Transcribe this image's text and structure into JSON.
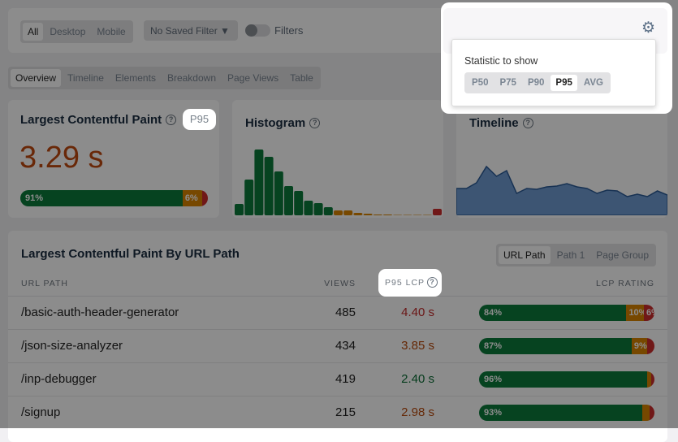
{
  "filters": {
    "device_options": [
      "All",
      "Desktop",
      "Mobile"
    ],
    "device_selected": "All",
    "saved_filter": "No Saved Filter",
    "toggle_label": "Filters"
  },
  "tabs": [
    "Overview",
    "Timeline",
    "Elements",
    "Breakdown",
    "Page Views",
    "Table"
  ],
  "active_tab": "Overview",
  "lcp_card": {
    "title": "Largest Contentful Paint",
    "badge": "P95",
    "value": "3.29 s",
    "rating": {
      "good": 91,
      "needs_improvement": 6,
      "poor": 3
    },
    "good_label": "91%",
    "ni_label": "6%"
  },
  "histogram": {
    "title": "Histogram",
    "bars": [
      14,
      44,
      81,
      72,
      54,
      36,
      30,
      18,
      15,
      10,
      6,
      6,
      3,
      2,
      1,
      1,
      0,
      0,
      0,
      0,
      8
    ],
    "colors": {
      "good": "#0b7a3b",
      "ni": "#d98400",
      "poor": "#cc2d2d"
    }
  },
  "timeline": {
    "title": "Timeline",
    "values": [
      33,
      33,
      40,
      60,
      48,
      55,
      27,
      33,
      32,
      35,
      36,
      39,
      35,
      33,
      27,
      31,
      30,
      23,
      26,
      23,
      30,
      25
    ],
    "color": "#2a5a96"
  },
  "popover": {
    "title": "Statistic to show",
    "options": [
      "P50",
      "P75",
      "P90",
      "P95",
      "AVG"
    ],
    "selected": "P95"
  },
  "table": {
    "title": "Largest Contentful Paint By URL Path",
    "group_options": [
      "URL Path",
      "Path 1",
      "Page Group"
    ],
    "group_selected": "URL Path",
    "headers": {
      "path": "URL PATH",
      "views": "VIEWS",
      "lcp": "P95 LCP",
      "rating": "LCP RATING"
    },
    "rows": [
      {
        "path": "/basic-auth-header-generator",
        "views": "485",
        "lcp": "4.40 s",
        "lcp_color": "#c42a2a",
        "good": 84,
        "ni": 10,
        "poor": 6,
        "good_label": "84%",
        "ni_label": "10%",
        "poor_label": "6%"
      },
      {
        "path": "/json-size-analyzer",
        "views": "434",
        "lcp": "3.85 s",
        "lcp_color": "#b84a0c",
        "good": 87,
        "ni": 9,
        "poor": 4,
        "good_label": "87%",
        "ni_label": "9%",
        "poor_label": ""
      },
      {
        "path": "/inp-debugger",
        "views": "419",
        "lcp": "2.40 s",
        "lcp_color": "#0b6e36",
        "good": 96,
        "ni": 2,
        "poor": 2,
        "good_label": "96%",
        "ni_label": "",
        "poor_label": ""
      },
      {
        "path": "/signup",
        "views": "215",
        "lcp": "2.98 s",
        "lcp_color": "#b84a0c",
        "good": 93,
        "ni": 4,
        "poor": 3,
        "good_label": "93%",
        "ni_label": "",
        "poor_label": ""
      }
    ]
  }
}
